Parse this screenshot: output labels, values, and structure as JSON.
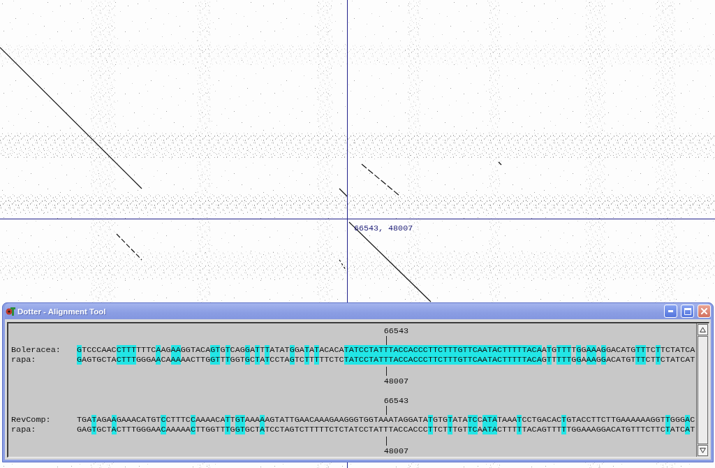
{
  "crosshair": {
    "readout": "66543, 48007"
  },
  "alignment_window": {
    "title": "Dotter - Alignment Tool",
    "blocks": [
      {
        "top_coordinate": "66543",
        "bottom_coordinate": "48007",
        "rows": [
          {
            "label": "Boleracea:",
            "segments": [
              {
                "text": "G",
                "highlighted": true
              },
              {
                "text": "TCCCAAC",
                "highlighted": false
              },
              {
                "text": "CTTT",
                "highlighted": true
              },
              {
                "text": "TTTC",
                "highlighted": false
              },
              {
                "text": "A",
                "highlighted": true
              },
              {
                "text": "AG",
                "highlighted": false
              },
              {
                "text": "AA",
                "highlighted": true
              },
              {
                "text": "GGTACA",
                "highlighted": false
              },
              {
                "text": "GT",
                "highlighted": true
              },
              {
                "text": "G",
                "highlighted": false
              },
              {
                "text": "T",
                "highlighted": true
              },
              {
                "text": "CAG",
                "highlighted": false
              },
              {
                "text": "G",
                "highlighted": true
              },
              {
                "text": "A",
                "highlighted": false
              },
              {
                "text": "T",
                "highlighted": true
              },
              {
                "text": "T",
                "highlighted": false
              },
              {
                "text": "T",
                "highlighted": true
              },
              {
                "text": "ATAT",
                "highlighted": false
              },
              {
                "text": "G",
                "highlighted": true
              },
              {
                "text": "GA",
                "highlighted": false
              },
              {
                "text": "T",
                "highlighted": true
              },
              {
                "text": "A",
                "highlighted": false
              },
              {
                "text": "T",
                "highlighted": true
              },
              {
                "text": "ACACA",
                "highlighted": false
              },
              {
                "text": "TATCCTATTTACCACCCTTCTTTGTTCAATACTTTTTACA",
                "highlighted": true
              },
              {
                "text": "A",
                "highlighted": false
              },
              {
                "text": "T",
                "highlighted": true
              },
              {
                "text": "G",
                "highlighted": false
              },
              {
                "text": "TTT",
                "highlighted": true
              },
              {
                "text": "T",
                "highlighted": false
              },
              {
                "text": "G",
                "highlighted": true
              },
              {
                "text": "G",
                "highlighted": false
              },
              {
                "text": "AA",
                "highlighted": true
              },
              {
                "text": "A",
                "highlighted": false
              },
              {
                "text": "G",
                "highlighted": true
              },
              {
                "text": "GACATG",
                "highlighted": false
              },
              {
                "text": "TT",
                "highlighted": true
              },
              {
                "text": "TC",
                "highlighted": false
              },
              {
                "text": "T",
                "highlighted": true
              },
              {
                "text": "TCTATCA",
                "highlighted": false
              }
            ]
          },
          {
            "label": "rapa:",
            "segments": [
              {
                "text": "G",
                "highlighted": true
              },
              {
                "text": "AGTGCTA",
                "highlighted": false
              },
              {
                "text": "CTTT",
                "highlighted": true
              },
              {
                "text": "GGGA",
                "highlighted": false
              },
              {
                "text": "A",
                "highlighted": true
              },
              {
                "text": "CA",
                "highlighted": false
              },
              {
                "text": "AA",
                "highlighted": true
              },
              {
                "text": "AACTTG",
                "highlighted": false
              },
              {
                "text": "GT",
                "highlighted": true
              },
              {
                "text": "T",
                "highlighted": false
              },
              {
                "text": "T",
                "highlighted": true
              },
              {
                "text": "GGT",
                "highlighted": false
              },
              {
                "text": "G",
                "highlighted": true
              },
              {
                "text": "C",
                "highlighted": false
              },
              {
                "text": "T",
                "highlighted": true
              },
              {
                "text": "A",
                "highlighted": false
              },
              {
                "text": "T",
                "highlighted": true
              },
              {
                "text": "CCTA",
                "highlighted": false
              },
              {
                "text": "G",
                "highlighted": true
              },
              {
                "text": "TC",
                "highlighted": false
              },
              {
                "text": "T",
                "highlighted": true
              },
              {
                "text": "T",
                "highlighted": false
              },
              {
                "text": "T",
                "highlighted": true
              },
              {
                "text": "TTCTC",
                "highlighted": false
              },
              {
                "text": "TATCCTATTTACCACCCTTCTTTGTTCAATACTTTTTACA",
                "highlighted": true
              },
              {
                "text": "G",
                "highlighted": false
              },
              {
                "text": "T",
                "highlighted": true
              },
              {
                "text": "T",
                "highlighted": false
              },
              {
                "text": "TTT",
                "highlighted": true
              },
              {
                "text": "G",
                "highlighted": false
              },
              {
                "text": "G",
                "highlighted": true
              },
              {
                "text": "A",
                "highlighted": false
              },
              {
                "text": "AA",
                "highlighted": true
              },
              {
                "text": "G",
                "highlighted": false
              },
              {
                "text": "G",
                "highlighted": true
              },
              {
                "text": "ACATGT",
                "highlighted": false
              },
              {
                "text": "TT",
                "highlighted": true
              },
              {
                "text": "CT",
                "highlighted": false
              },
              {
                "text": "T",
                "highlighted": true
              },
              {
                "text": "CTATCAT",
                "highlighted": false
              }
            ]
          }
        ]
      },
      {
        "top_coordinate": "66543",
        "bottom_coordinate": "48007",
        "rows": [
          {
            "label": "RevComp:",
            "segments": [
              {
                "text": "TGA",
                "highlighted": false
              },
              {
                "text": "T",
                "highlighted": true
              },
              {
                "text": "AGA",
                "highlighted": false
              },
              {
                "text": "A",
                "highlighted": true
              },
              {
                "text": "GAAACATGT",
                "highlighted": false
              },
              {
                "text": "C",
                "highlighted": true
              },
              {
                "text": "CTTTC",
                "highlighted": false
              },
              {
                "text": "C",
                "highlighted": true
              },
              {
                "text": "AAAACA",
                "highlighted": false
              },
              {
                "text": "T",
                "highlighted": true
              },
              {
                "text": "T",
                "highlighted": false
              },
              {
                "text": "GT",
                "highlighted": true
              },
              {
                "text": "AAA",
                "highlighted": false
              },
              {
                "text": "A",
                "highlighted": true
              },
              {
                "text": "AGTATTGAACAAAGAAGGGTGGTAAATAGGATA",
                "highlighted": false
              },
              {
                "text": "T",
                "highlighted": true
              },
              {
                "text": "GTG",
                "highlighted": false
              },
              {
                "text": "T",
                "highlighted": true
              },
              {
                "text": "ATA",
                "highlighted": false
              },
              {
                "text": "TC",
                "highlighted": true
              },
              {
                "text": "C",
                "highlighted": false
              },
              {
                "text": "ATA",
                "highlighted": true
              },
              {
                "text": "TAAA",
                "highlighted": false
              },
              {
                "text": "T",
                "highlighted": true
              },
              {
                "text": "CCTGACAC",
                "highlighted": false
              },
              {
                "text": "T",
                "highlighted": true
              },
              {
                "text": "GTACCTTCTTGAAAAAAGGT",
                "highlighted": false
              },
              {
                "text": "T",
                "highlighted": true
              },
              {
                "text": "GGG",
                "highlighted": false
              },
              {
                "text": "A",
                "highlighted": true
              },
              {
                "text": "C",
                "highlighted": false
              }
            ]
          },
          {
            "label": "rapa:",
            "segments": [
              {
                "text": "GAG",
                "highlighted": false
              },
              {
                "text": "T",
                "highlighted": true
              },
              {
                "text": "GCT",
                "highlighted": false
              },
              {
                "text": "A",
                "highlighted": true
              },
              {
                "text": "CTTTGGGAA",
                "highlighted": false
              },
              {
                "text": "C",
                "highlighted": true
              },
              {
                "text": "AAAAA",
                "highlighted": false
              },
              {
                "text": "C",
                "highlighted": true
              },
              {
                "text": "TTGGTT",
                "highlighted": false
              },
              {
                "text": "T",
                "highlighted": true
              },
              {
                "text": "G",
                "highlighted": false
              },
              {
                "text": "GT",
                "highlighted": true
              },
              {
                "text": "GCT",
                "highlighted": false
              },
              {
                "text": "A",
                "highlighted": true
              },
              {
                "text": "TCCTAGTCTTTTTCTCTATCCTATTTACCACCC",
                "highlighted": false
              },
              {
                "text": "T",
                "highlighted": true
              },
              {
                "text": "TCT",
                "highlighted": false
              },
              {
                "text": "T",
                "highlighted": true
              },
              {
                "text": "TGT",
                "highlighted": false
              },
              {
                "text": "TC",
                "highlighted": true
              },
              {
                "text": "A",
                "highlighted": false
              },
              {
                "text": "ATA",
                "highlighted": true
              },
              {
                "text": "CTTT",
                "highlighted": false
              },
              {
                "text": "T",
                "highlighted": true
              },
              {
                "text": "TACAGTTT",
                "highlighted": false
              },
              {
                "text": "T",
                "highlighted": true
              },
              {
                "text": "TGGAAAGGACATGTTTCTTC",
                "highlighted": false
              },
              {
                "text": "T",
                "highlighted": true
              },
              {
                "text": "ATC",
                "highlighted": false
              },
              {
                "text": "A",
                "highlighted": true
              },
              {
                "text": "T",
                "highlighted": false
              }
            ]
          }
        ]
      }
    ]
  }
}
